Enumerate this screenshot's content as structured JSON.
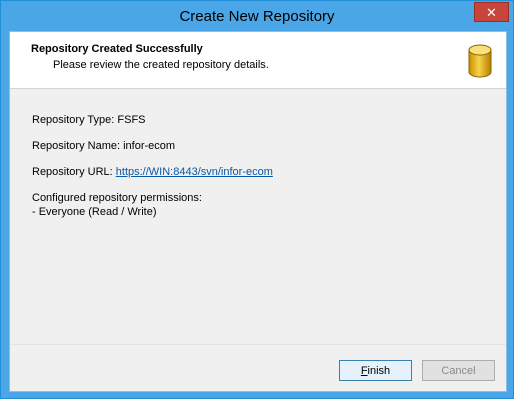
{
  "window": {
    "title": "Create New Repository",
    "close_glyph": "✕"
  },
  "header": {
    "title": "Repository Created Successfully",
    "subtitle": "Please review the created repository details.",
    "icon": "database-icon"
  },
  "details": {
    "type_label": "Repository Type: FSFS",
    "name_label": "Repository Name: infor-ecom",
    "url_prefix": "Repository URL: ",
    "url": "https://WIN:8443/svn/infor-ecom",
    "permissions_title": "Configured repository permissions:",
    "permissions": [
      "- Everyone (Read / Write)"
    ]
  },
  "buttons": {
    "finish_mnemonic": "F",
    "finish_rest": "inish",
    "cancel": "Cancel"
  },
  "colors": {
    "titlebar": "#4aa6e6",
    "close": "#c7453a",
    "link": "#0b57a8",
    "icon_gold": "#e8b81c"
  }
}
